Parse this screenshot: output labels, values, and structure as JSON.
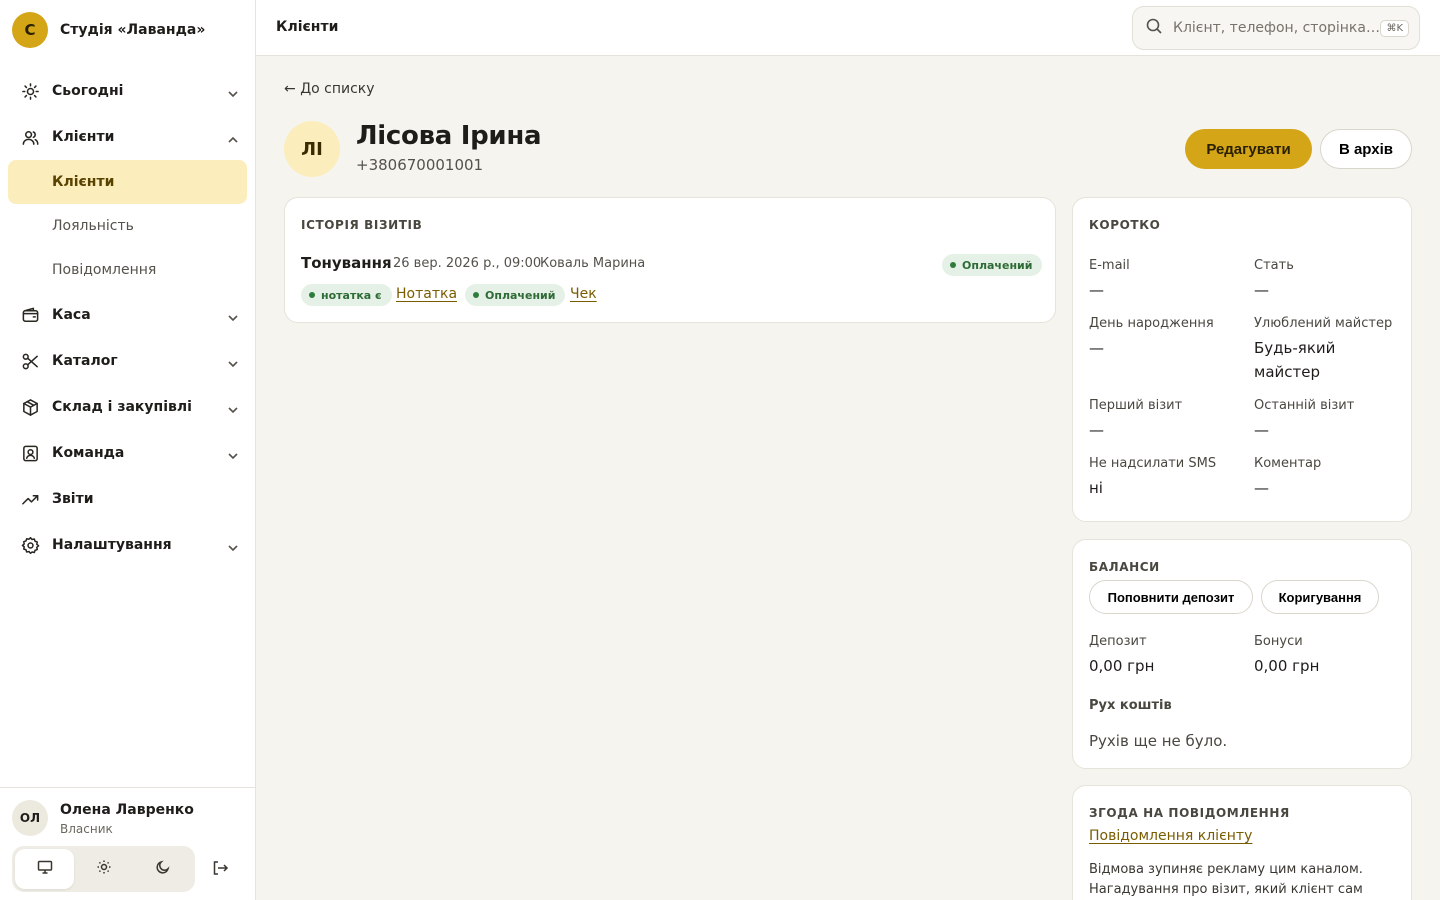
{
  "brand": {
    "logo_letter": "С",
    "name": "Студія «Лаванда»"
  },
  "nav": {
    "today": "Сьогодні",
    "clients": "Клієнти",
    "sub": {
      "clients": "Клієнти",
      "loyalty": "Лояльність",
      "messages": "Повідомлення"
    },
    "cash": "Каса",
    "catalog": "Каталог",
    "stock": "Склад і закупівлі",
    "team": "Команда",
    "reports": "Звіти",
    "settings": "Налаштування"
  },
  "user": {
    "initials": "ОЛ",
    "name": "Олена Лавренко",
    "role": "Власник"
  },
  "topbar": {
    "title": "Клієнти",
    "search_placeholder": "Клієнт, телефон, сторінка…",
    "shortcut": "⌘K"
  },
  "client": {
    "back": "До списку",
    "initials": "ЛІ",
    "name": "Лісова Ірина",
    "phone": "+380670001001",
    "edit": "Редагувати",
    "archive": "В архів"
  },
  "history": {
    "title": "ІСТОРІЯ ВІЗИТІВ",
    "visit": {
      "service": "Тонування",
      "date": "26 вер. 2026 р., 09:00",
      "master": "Коваль Марина",
      "status": "Оплачений",
      "note_badge": "нотатка є",
      "note_link": "Нотатка",
      "pay_badge": "Оплачений",
      "receipt_link": "Чек"
    }
  },
  "summary": {
    "title": "КОРОТКО",
    "email_label": "E-mail",
    "email": "—",
    "gender_label": "Стать",
    "gender": "—",
    "birthday_label": "День народження",
    "birthday": "—",
    "master_label": "Улюблений майстер",
    "master_line1": "Будь-який",
    "master_line2": "майстер",
    "first_label": "Перший візит",
    "first": "—",
    "last_label": "Останній візит",
    "last": "—",
    "sms_label": "Не надсилати SMS",
    "sms": "ні",
    "comment_label": "Коментар",
    "comment": "—"
  },
  "balances": {
    "title": "БАЛАНСИ",
    "topup": "Поповнити депозит",
    "adjust": "Коригування",
    "deposit_label": "Депозит",
    "deposit": "0,00 грн",
    "bonus_label": "Бонуси",
    "bonus": "0,00 грн",
    "movement_label": "Рух коштів",
    "movement_empty": "Рухів ще не було."
  },
  "consent": {
    "title": "ЗГОДА НА ПОВІДОМЛЕННЯ",
    "link": "Повідомлення клієнту",
    "text": "Відмова зупиняє рекламу цим каналом. Нагадування про візит, який клієнт сам"
  },
  "colors": {
    "accent": "#d4a517",
    "active_bg": "#fbeebc",
    "paid_bg": "#e5f1e6",
    "paid_fg": "#2e6b36"
  }
}
